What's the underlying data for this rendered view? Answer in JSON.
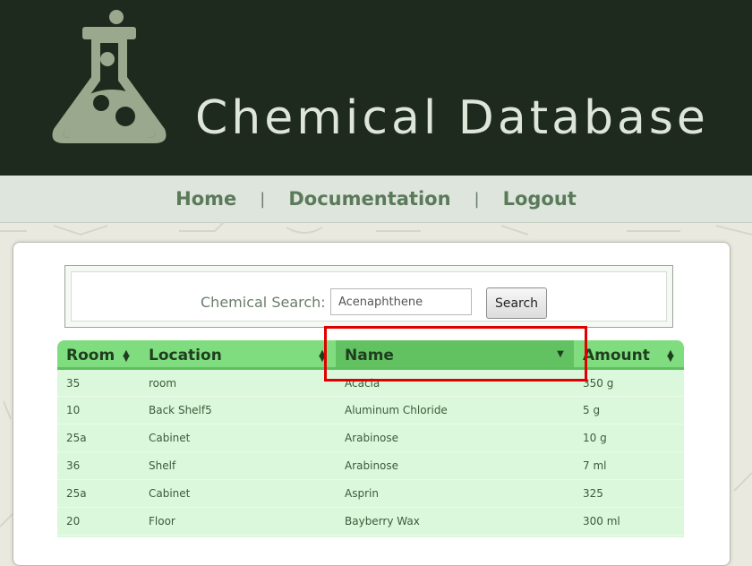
{
  "header": {
    "title": "Chemical Database",
    "logo_icon": "flask-icon"
  },
  "nav": {
    "items": [
      "Home",
      "Documentation",
      "Logout"
    ],
    "separator": "|"
  },
  "search": {
    "label": "Chemical Search:",
    "placeholder": "Acenaphthene",
    "button_label": "Search"
  },
  "table": {
    "columns": [
      "Room",
      "Location",
      "Name",
      "Amount"
    ],
    "sorted_column": "Name",
    "sort_direction": "descending",
    "rows": [
      [
        "35",
        "room",
        "Acacia",
        "350 g"
      ],
      [
        "10",
        "Back Shelf5",
        "Aluminum Chloride",
        "5 g"
      ],
      [
        "25a",
        "Cabinet",
        "Arabinose",
        "10 g"
      ],
      [
        "36",
        "Shelf",
        "Arabinose",
        "7 ml"
      ],
      [
        "25a",
        "Cabinet",
        "Asprin",
        "325"
      ],
      [
        "20",
        "Floor",
        "Bayberry Wax",
        "300 ml"
      ],
      [
        "",
        "",
        "",
        ""
      ]
    ]
  },
  "colors": {
    "header_bg": "#1f2a1e",
    "nav_link": "#5b7a5a",
    "table_header": "#7fdd7f",
    "table_header_active": "#62c262",
    "row_bg": "#dcf8dc",
    "highlight": "#e10000"
  }
}
